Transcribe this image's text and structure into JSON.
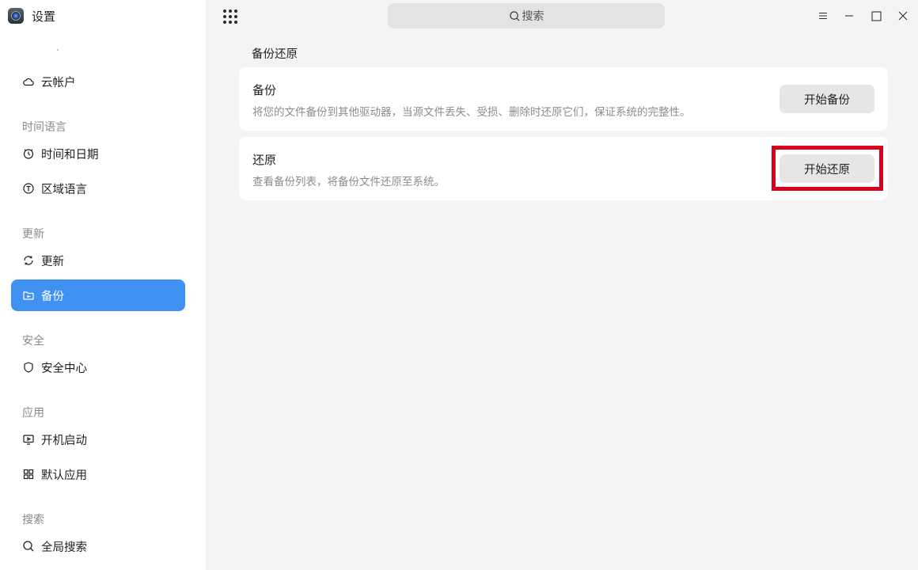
{
  "app": {
    "title": "设置"
  },
  "sidebar": {
    "items": [
      {
        "label": "云帐户",
        "icon": "cloud-icon"
      },
      {
        "group": "时间语言"
      },
      {
        "label": "时间和日期",
        "icon": "clock-icon"
      },
      {
        "label": "区域语言",
        "icon": "language-icon"
      },
      {
        "group": "更新"
      },
      {
        "label": "更新",
        "icon": "refresh-icon"
      },
      {
        "label": "备份",
        "icon": "folder-backup-icon",
        "active": true
      },
      {
        "group": "安全"
      },
      {
        "label": "安全中心",
        "icon": "shield-icon"
      },
      {
        "group": "应用"
      },
      {
        "label": "开机启动",
        "icon": "startup-icon"
      },
      {
        "label": "默认应用",
        "icon": "grid-apps-icon"
      },
      {
        "group": "搜索"
      },
      {
        "label": "全局搜索",
        "icon": "search-icon"
      }
    ]
  },
  "topbar": {
    "search_placeholder": "搜索"
  },
  "main": {
    "title": "备份还原",
    "cards": [
      {
        "title": "备份",
        "description": "将您的文件备份到其他驱动器，当源文件丢失、受损、删除时还原它们，保证系统的完整性。",
        "button": "开始备份"
      },
      {
        "title": "还原",
        "description": "查看备份列表，将备份文件还原至系统。",
        "button": "开始还原"
      }
    ]
  },
  "colors": {
    "accent": "#3f92f2",
    "highlight": "#d8001a"
  }
}
